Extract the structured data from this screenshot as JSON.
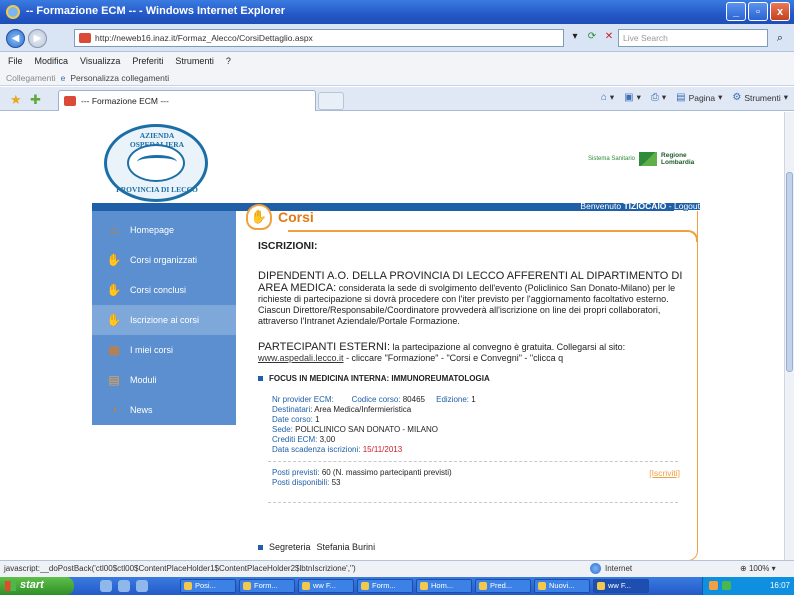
{
  "window": {
    "title": "-- Formazione ECM -- - Windows Internet Explorer",
    "buttons": [
      "_",
      "▫",
      "x"
    ]
  },
  "addressbar": {
    "url": "http://neweb16.inaz.it/Formaz_Alecco/CorsiDettaglio.aspx",
    "search_placeholder": "Live Search"
  },
  "menu": {
    "items": [
      "File",
      "Modifica",
      "Visualizza",
      "Preferiti",
      "Strumenti",
      "?"
    ]
  },
  "links_bar": {
    "label": "Collegamenti",
    "item": "Personalizza collegamenti"
  },
  "tab": {
    "title": "--- Formazione ECM ---"
  },
  "command_bar": {
    "pagina": "Pagina",
    "strumenti": "Strumenti"
  },
  "site": {
    "logo_top": "AZIENDA OSPEDALIERA",
    "logo_bottom": "PROVINCIA DI LECCO",
    "region_system": "Sistema Sanitario",
    "region_name_1": "Regione",
    "region_name_2": "Lombardia",
    "welcome_prefix": "Benvenuto",
    "username": "TIZIOCAIO",
    "logout": "Logout"
  },
  "sidebar": {
    "items": [
      {
        "label": "Homepage",
        "icon": "home-icon"
      },
      {
        "label": "Corsi organizzati",
        "icon": "hand-icon"
      },
      {
        "label": "Corsi conclusi",
        "icon": "hand-icon"
      },
      {
        "label": "Iscrizione ai corsi",
        "icon": "hand-icon"
      },
      {
        "label": "I miei corsi",
        "icon": "folder-icon"
      },
      {
        "label": "Moduli",
        "icon": "form-icon"
      },
      {
        "label": "News",
        "icon": "rss-icon"
      }
    ],
    "active_index": 3
  },
  "content": {
    "section_title": "Corsi",
    "heading": "ISCRIZIONI:",
    "dip_title": "DIPENDENTI A.O. DELLA PROVINCIA DI LECCO AFFERENTI AL DIPARTIMENTO DI AREA MEDICA:",
    "dip_text": "considerata la sede di svolgimento dell'evento (Policlinico San Donato-Milano) per le richieste di partecipazione si dovrà procedere con l'iter previsto per l'aggiornamento facoltativo esterno. Ciascun Direttore/Responsabile/Coordinatore provvederà all'iscrizione on line dei propri collaboratori, attraverso l'Intranet Aziendale/Portale Formazione.",
    "ext_title": "PARTECIPANTI ESTERNI:",
    "ext_text": "la partecipazione al convegno è gratuita. Collegarsi al sito:",
    "ext_link": "www.aspedali.lecco.it",
    "ext_tail": "- cliccare \"Formazione\" - \"Corsi e Convegni\" - \"clicca q",
    "course_title": "FOCUS IN MEDICINA INTERNA: IMMUNOREUMATOLOGIA",
    "provider_label": "Nr provider ECM:",
    "codice_label": "Codice corso:",
    "codice_value": "80465",
    "edizione_label": "Edizione:",
    "edizione_value": "1",
    "destinatari_label": "Destinatari:",
    "destinatari_value": "Area Medica/Infermieristica",
    "date_label": "Date corso:",
    "date_value": "1",
    "sede_label": "Sede:",
    "sede_value": "POLICLINICO SAN DONATO - MILANO",
    "crediti_label": "Crediti ECM:",
    "crediti_value": "3,00",
    "scadenza_label": "Data scadenza iscrizioni:",
    "scadenza_value": "15/11/2013",
    "posti_previsti_label": "Posti previsti:",
    "posti_previsti_value": "60 (N. massimo partecipanti previsti)",
    "posti_disp_label": "Posti disponibili:",
    "posti_disp_value": "53",
    "iscriviti": "[Iscriviti]",
    "segreteria_label": "Segreteria",
    "segreteria_value": "Stefania Burini"
  },
  "statusbar": {
    "js": "javascript:__doPostBack('ctl00$ctl00$ContentPlaceHolder1$ContentPlaceHolder2$lbtnIscrizione','')",
    "zone": "Internet",
    "zoom": "100%"
  },
  "taskbar": {
    "start": "start",
    "tasks": [
      "Posi...",
      "Form...",
      "ww F...",
      "Form...",
      "Hom...",
      "Pred...",
      "Nuovi...",
      "ww F..."
    ],
    "clock": "16:07"
  }
}
